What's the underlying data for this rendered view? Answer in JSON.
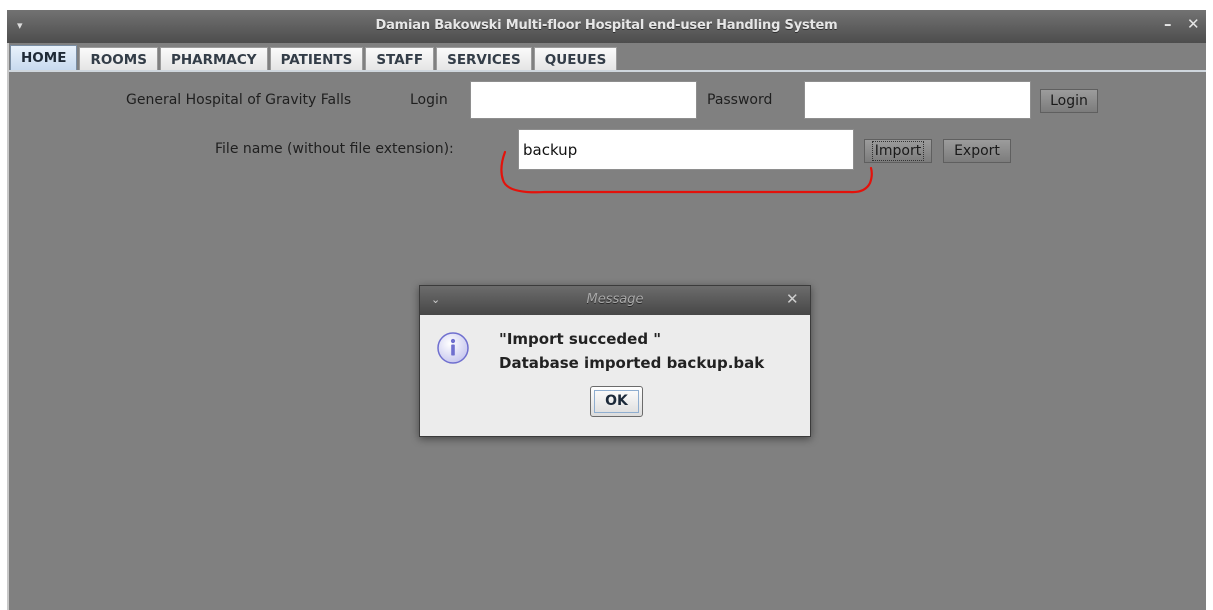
{
  "window": {
    "title": "Damian Bakowski Multi-floor Hospital end-user Handling System",
    "menu_glyph": "▾",
    "minimize_glyph": "–",
    "close_glyph": "✕"
  },
  "tabs": [
    {
      "label": "HOME",
      "active": true
    },
    {
      "label": "ROOMS"
    },
    {
      "label": "PHARMACY"
    },
    {
      "label": "PATIENTS"
    },
    {
      "label": "STAFF"
    },
    {
      "label": "SERVICES"
    },
    {
      "label": "QUEUES"
    }
  ],
  "login_row": {
    "hospital_label": "General Hospital of Gravity Falls",
    "login_label": "Login",
    "login_value": "",
    "password_label": "Password",
    "password_value": "",
    "login_button": "Login"
  },
  "file_row": {
    "file_label": "File name (without file extension):",
    "file_value": "backup",
    "import_button": "Import",
    "export_button": "Export"
  },
  "dialog": {
    "title": "Message",
    "menu_glyph": "⌄",
    "close_glyph": "✕",
    "icon": "info-icon",
    "line1": "\"Import succeded \"",
    "line2": "Database imported backup.bak",
    "ok_label": "OK"
  },
  "colors": {
    "annotation": "#e3120b",
    "info_icon": "#6f6fcf"
  }
}
